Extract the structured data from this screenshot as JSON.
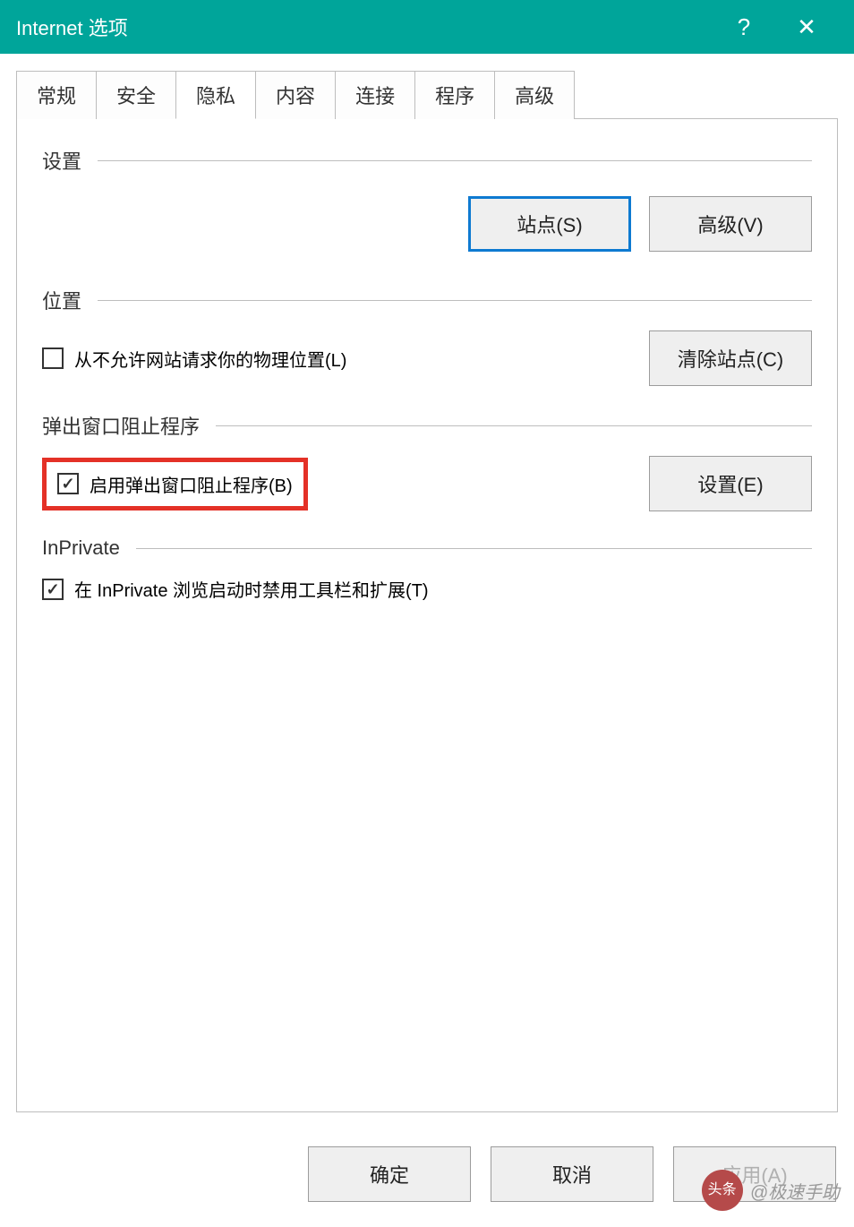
{
  "titlebar": {
    "title": "Internet 选项",
    "help": "?",
    "close": "✕"
  },
  "tabs": [
    {
      "label": "常规"
    },
    {
      "label": "安全"
    },
    {
      "label": "隐私"
    },
    {
      "label": "内容"
    },
    {
      "label": "连接"
    },
    {
      "label": "程序"
    },
    {
      "label": "高级"
    }
  ],
  "active_tab_index": 2,
  "sections": {
    "settings": {
      "label": "设置",
      "sites_btn": "站点(S)",
      "advanced_btn": "高级(V)"
    },
    "location": {
      "label": "位置",
      "never_allow_chk_checked": false,
      "never_allow_chk_label": "从不允许网站请求你的物理位置(L)",
      "clear_sites_btn": "清除站点(C)"
    },
    "popup": {
      "label": "弹出窗口阻止程序",
      "enable_chk_checked": true,
      "enable_chk_label": "启用弹出窗口阻止程序(B)",
      "settings_btn": "设置(E)"
    },
    "inprivate": {
      "label": "InPrivate",
      "disable_ext_chk_checked": true,
      "disable_ext_chk_label": "在 InPrivate 浏览启动时禁用工具栏和扩展(T)"
    }
  },
  "footer": {
    "ok": "确定",
    "cancel": "取消",
    "apply": "应用(A)"
  },
  "watermark": {
    "icon_text": "头条",
    "text": "@极速手助"
  }
}
